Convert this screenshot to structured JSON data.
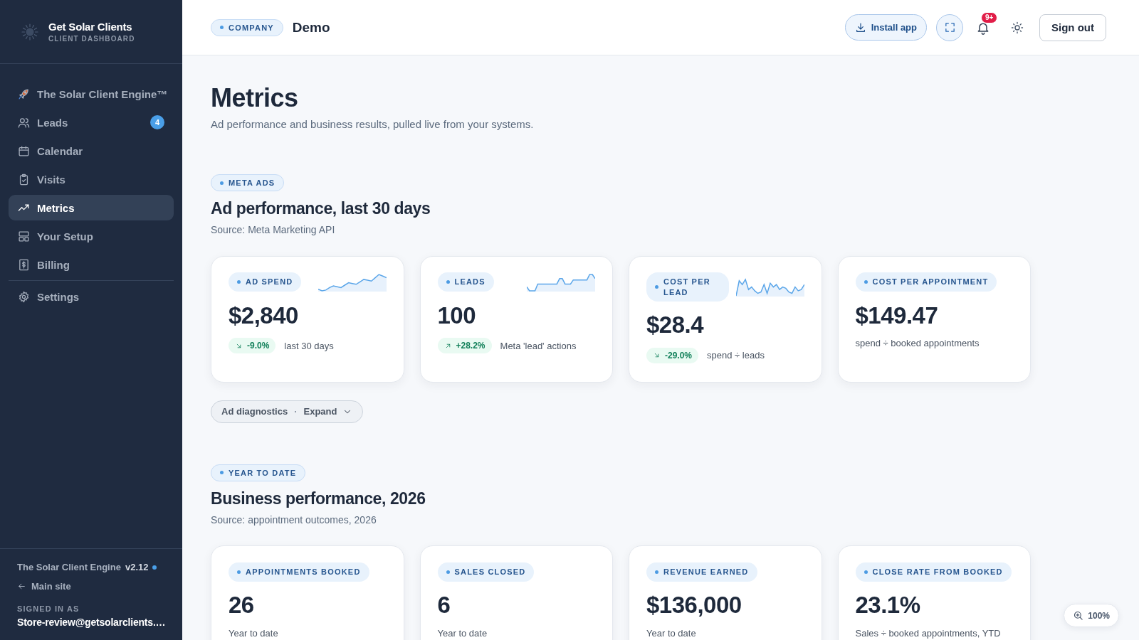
{
  "sidebar": {
    "brand": {
      "name": "Get Solar Clients",
      "subtitle": "CLIENT DASHBOARD"
    },
    "nav": [
      {
        "label": "The Solar Client Engine™",
        "selected": false
      },
      {
        "label": "Leads",
        "selected": false,
        "badge": "4"
      },
      {
        "label": "Calendar",
        "selected": false
      },
      {
        "label": "Visits",
        "selected": false
      },
      {
        "label": "Metrics",
        "selected": true
      },
      {
        "label": "Your Setup",
        "selected": false
      },
      {
        "label": "Billing",
        "selected": false
      }
    ],
    "secondary_nav": [
      {
        "label": "Settings",
        "selected": false
      }
    ],
    "footer": {
      "product": "The Solar Client Engine",
      "version": "v2.12",
      "back_link": "Main site",
      "signed_in_label": "SIGNED IN AS",
      "account": "Store-review@getsolarclients.…"
    }
  },
  "header": {
    "company_tag": "COMPANY",
    "company_name": "Demo",
    "install_button": "Install app",
    "notification_badge": "9+",
    "sign_out_button": "Sign out"
  },
  "page": {
    "title": "Metrics",
    "subtitle": "Ad performance and business results, pulled live from your systems."
  },
  "sections": [
    {
      "tag": "META ADS",
      "heading": "Ad performance, last 30 days",
      "source": "Source: Meta Marketing API",
      "cards": [
        {
          "label": "AD SPEND",
          "value": "$2,840",
          "sparkline": true,
          "trend": {
            "rising": false,
            "change": "-9.0%"
          },
          "note": "last 30 days"
        },
        {
          "label": "LEADS",
          "value": "100",
          "sparkline": true,
          "trend": {
            "rising": true,
            "change": "+28.2%"
          },
          "note": "Meta 'lead' actions"
        },
        {
          "label": "COST PER LEAD",
          "value": "$28.4",
          "sparkline": true,
          "trend": {
            "rising": false,
            "change": "-29.0%"
          },
          "note": "spend ÷ leads"
        },
        {
          "label": "COST PER APPOINTMENT",
          "value": "$149.47",
          "note": "spend ÷ booked appointments"
        }
      ],
      "toggle": {
        "label": "Ad diagnostics",
        "separator": "·",
        "action": "Expand",
        "expanded": false
      }
    },
    {
      "tag": "YEAR TO DATE",
      "heading": "Business performance, 2026",
      "source": "Source: appointment outcomes, 2026",
      "cards": [
        {
          "label": "APPOINTMENTS BOOKED",
          "value": "26",
          "note": "Year to date"
        },
        {
          "label": "SALES CLOSED",
          "value": "6",
          "note": "Year to date"
        },
        {
          "label": "REVENUE EARNED",
          "value": "$136,000",
          "note": "Year to date"
        },
        {
          "label": "CLOSE RATE FROM BOOKED",
          "value": "23.1%",
          "note": "Sales ÷ booked appointments, YTD"
        }
      ]
    }
  ],
  "zoom_indicator": "100%"
}
